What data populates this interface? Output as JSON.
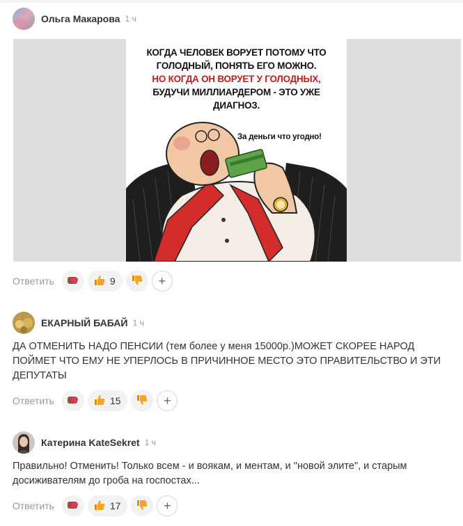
{
  "comments": [
    {
      "author": "Ольга Макарова",
      "time": "1 ч",
      "image": {
        "lines_black_1": [
          "КОГДА ЧЕЛОВЕК ВОРУЕТ ПОТОМУ ЧТО",
          "ГОЛОДНЫЙ, ПОНЯТЬ ЕГО МОЖНО."
        ],
        "lines_red": [
          "НО КОГДА ОН ВОРУЕТ У ГОЛОДНЫХ,"
        ],
        "lines_black_2": [
          "БУДУЧИ МИЛЛИАРДЕРОМ - ЭТО УЖЕ",
          "ДИАГНОЗ."
        ],
        "caption": "За деньги что угодно!"
      },
      "reply_label": "Ответить",
      "likes": "9"
    },
    {
      "author": "ЕКАРНЫЙ БАБАЙ",
      "time": "1 ч",
      "text": "ДА ОТМЕНИТЬ НАДО ПЕНСИИ (тем более у меня 15000р.)МОЖЕТ СКОРЕЕ НАРОД ПОЙМЕТ ЧТО ЕМУ НЕ УПЕРЛОСЬ В ПРИЧИННОЕ МЕСТО ЭТО ПРАВИТЕЛЬСТВО И ЭТИ ДЕПУТАТЫ",
      "reply_label": "Ответить",
      "likes": "15"
    },
    {
      "author": "Катерина KateSekret",
      "time": "1 ч",
      "text": "Правильно! Отменить! Только всем - и воякам, и ментам, и \"новой элите\", и старым досиживателям до гроба на госпостах...",
      "reply_label": "Ответить",
      "likes": "17"
    }
  ],
  "icons": {
    "love": "heart-reaction-icon",
    "like": "thumbs-up-icon",
    "dislike": "thumbs-down-icon",
    "add": "plus-icon"
  },
  "colors": {
    "like": "#f5a524",
    "dislike": "#f5a524",
    "heart": "#e5355a",
    "muted": "#999999"
  }
}
